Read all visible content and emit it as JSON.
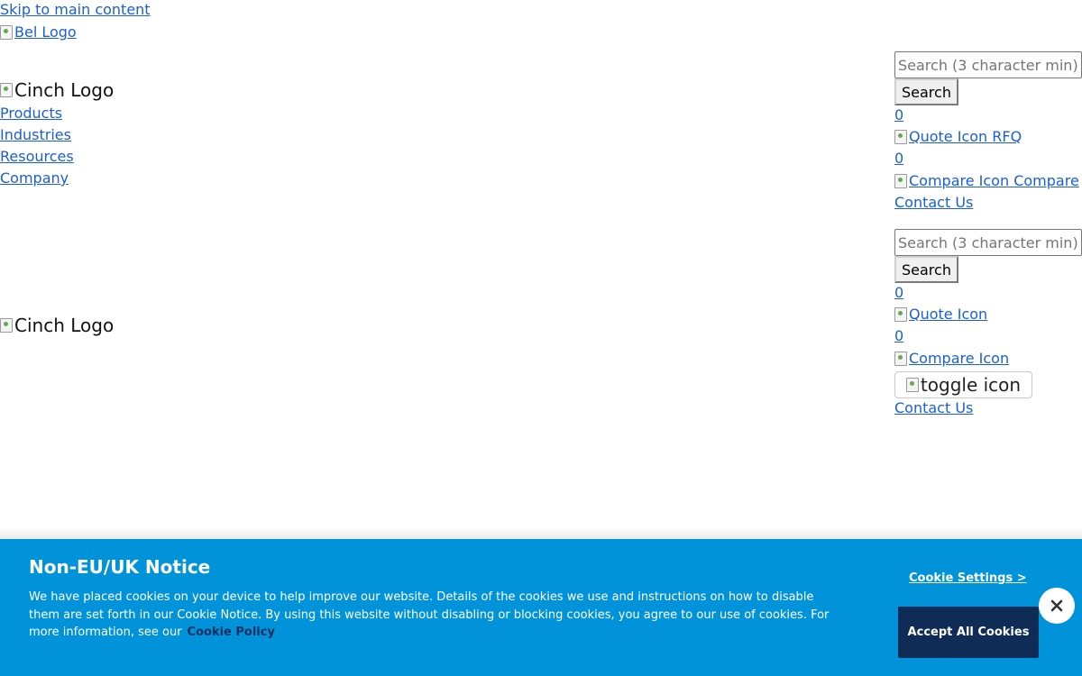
{
  "skip_link": "Skip to main content",
  "top_logo_alt": "Bel Logo",
  "header": {
    "logo_alt": "Cinch Logo",
    "nav": [
      "Products",
      "Industries",
      "Resources",
      "Company"
    ],
    "search_placeholder": "Search (3 character min)",
    "search_button": "Search",
    "quote_count": "0",
    "quote_icon_alt": "Quote Icon",
    "quote_label": "RFQ",
    "compare_count": "0",
    "compare_icon_alt": "Compare Icon",
    "compare_label": "Compare",
    "contact": "Contact Us"
  },
  "mobile_header": {
    "logo_alt": "Cinch Logo",
    "search_placeholder": "Search (3 character min)",
    "search_button": "Search",
    "quote_count": "0",
    "quote_icon_alt": "Quote Icon",
    "compare_count": "0",
    "compare_icon_alt": "Compare Icon",
    "toggle_alt": "toggle icon",
    "contact": "Contact Us"
  },
  "cookie": {
    "title": "Non-EU/UK Notice",
    "text": "We have placed cookies on your device to help improve our website. Details of the cookies we use and instructions on how to disable them are set forth in our Cookie Notice. By using this website without disabling or blocking cookies, you agree to our use of cookies. For more information, see our",
    "policy_link": "Cookie Policy",
    "settings_label": "Cookie Settings >",
    "accept_label": "Accept All Cookies",
    "colors": {
      "banner": "#0093d9",
      "accept_bg": "#0e2c56",
      "policy_link": "#0c2f63"
    }
  },
  "icons": {
    "broken_image": "broken-image-icon",
    "close": "close-icon"
  }
}
